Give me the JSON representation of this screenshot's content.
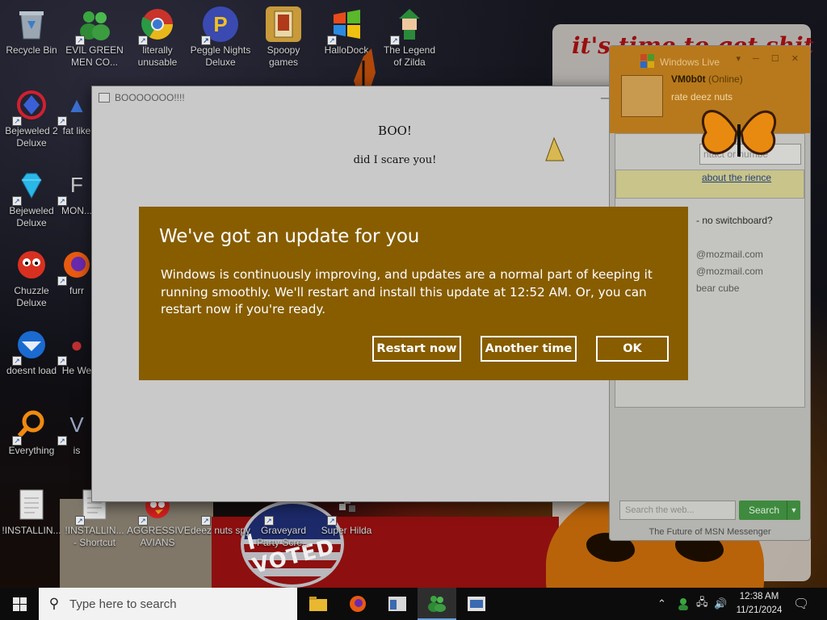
{
  "desktop": {
    "wallpaper_text": "it's time to get shit and",
    "badge_text": "I VOTED",
    "icons": [
      {
        "label": "Recycle Bin"
      },
      {
        "label": "EVIL GREEN MEN CO..."
      },
      {
        "label": "literally unusable"
      },
      {
        "label": "Peggle Nights Deluxe"
      },
      {
        "label": "Spoopy games"
      },
      {
        "label": "HalloDock"
      },
      {
        "label": "The Legend of Zilda"
      },
      {
        "label": "Bejeweled 2 Deluxe"
      },
      {
        "label": "fat like"
      },
      {
        "label": "Bejeweled Deluxe"
      },
      {
        "label": "MON..."
      },
      {
        "label": "Chuzzle Deluxe"
      },
      {
        "label": "furr"
      },
      {
        "label": "doesnt load"
      },
      {
        "label": "He We"
      },
      {
        "label": "Everything"
      },
      {
        "label": "is"
      },
      {
        "label": "!INSTALLIN..."
      },
      {
        "label": "!INSTALLIN... - Shortcut"
      },
      {
        "label": "AGGRESSIVE AVIANS"
      },
      {
        "label": "deez nuts spy"
      },
      {
        "label": "Graveyard Party Scre..."
      },
      {
        "label": "Super Hilda"
      }
    ]
  },
  "boo_window": {
    "title": "BOOOOOOO!!!!",
    "heading": "BOO!",
    "text": "did I scare you!"
  },
  "update_dialog": {
    "title": "We've got an update for you",
    "body": "Windows is continuously improving, and updates are a normal part of keeping it running smoothly. We'll restart and install this update at 12:52 AM. Or, you can restart now if you're ready.",
    "buttons": {
      "restart": "Restart now",
      "another_time": "Another time",
      "ok": "OK"
    }
  },
  "messenger": {
    "title": "Windows Live",
    "user": "VM0b0t",
    "status": "(Online)",
    "psm": "rate deez nuts",
    "find_placeholder": "ntact or numbe",
    "news_link": "about the rience",
    "contacts": [
      "- no switchboard?",
      "@mozmail.com",
      "@mozmail.com",
      "bear cube"
    ],
    "search_placeholder": "Search the web...",
    "search_label": "Search",
    "footer": "The Future of MSN Messenger"
  },
  "taskbar": {
    "search_placeholder": "Type here to search",
    "time": "12:38 AM",
    "date": "11/21/2024"
  },
  "colors": {
    "update_bg": "#875d00",
    "taskbar": "#0c0c0c",
    "window_bg": "#c9c9c9"
  }
}
